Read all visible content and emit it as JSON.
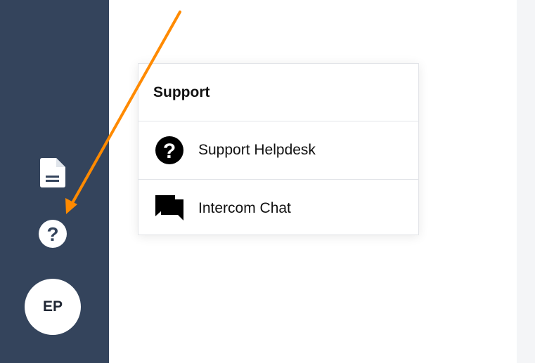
{
  "sidebar": {
    "items": [
      {
        "icon": "document-icon"
      },
      {
        "icon": "help-circle-icon"
      }
    ],
    "avatar_initials": "EP"
  },
  "support_menu": {
    "title": "Support",
    "items": [
      {
        "label": "Support Helpdesk",
        "icon": "question-circle-icon"
      },
      {
        "label": "Intercom Chat",
        "icon": "chat-bubbles-icon"
      }
    ]
  },
  "colors": {
    "sidebar": "#34445c",
    "annotation_arrow": "#ff8a00",
    "page_background": "#ffffff"
  }
}
